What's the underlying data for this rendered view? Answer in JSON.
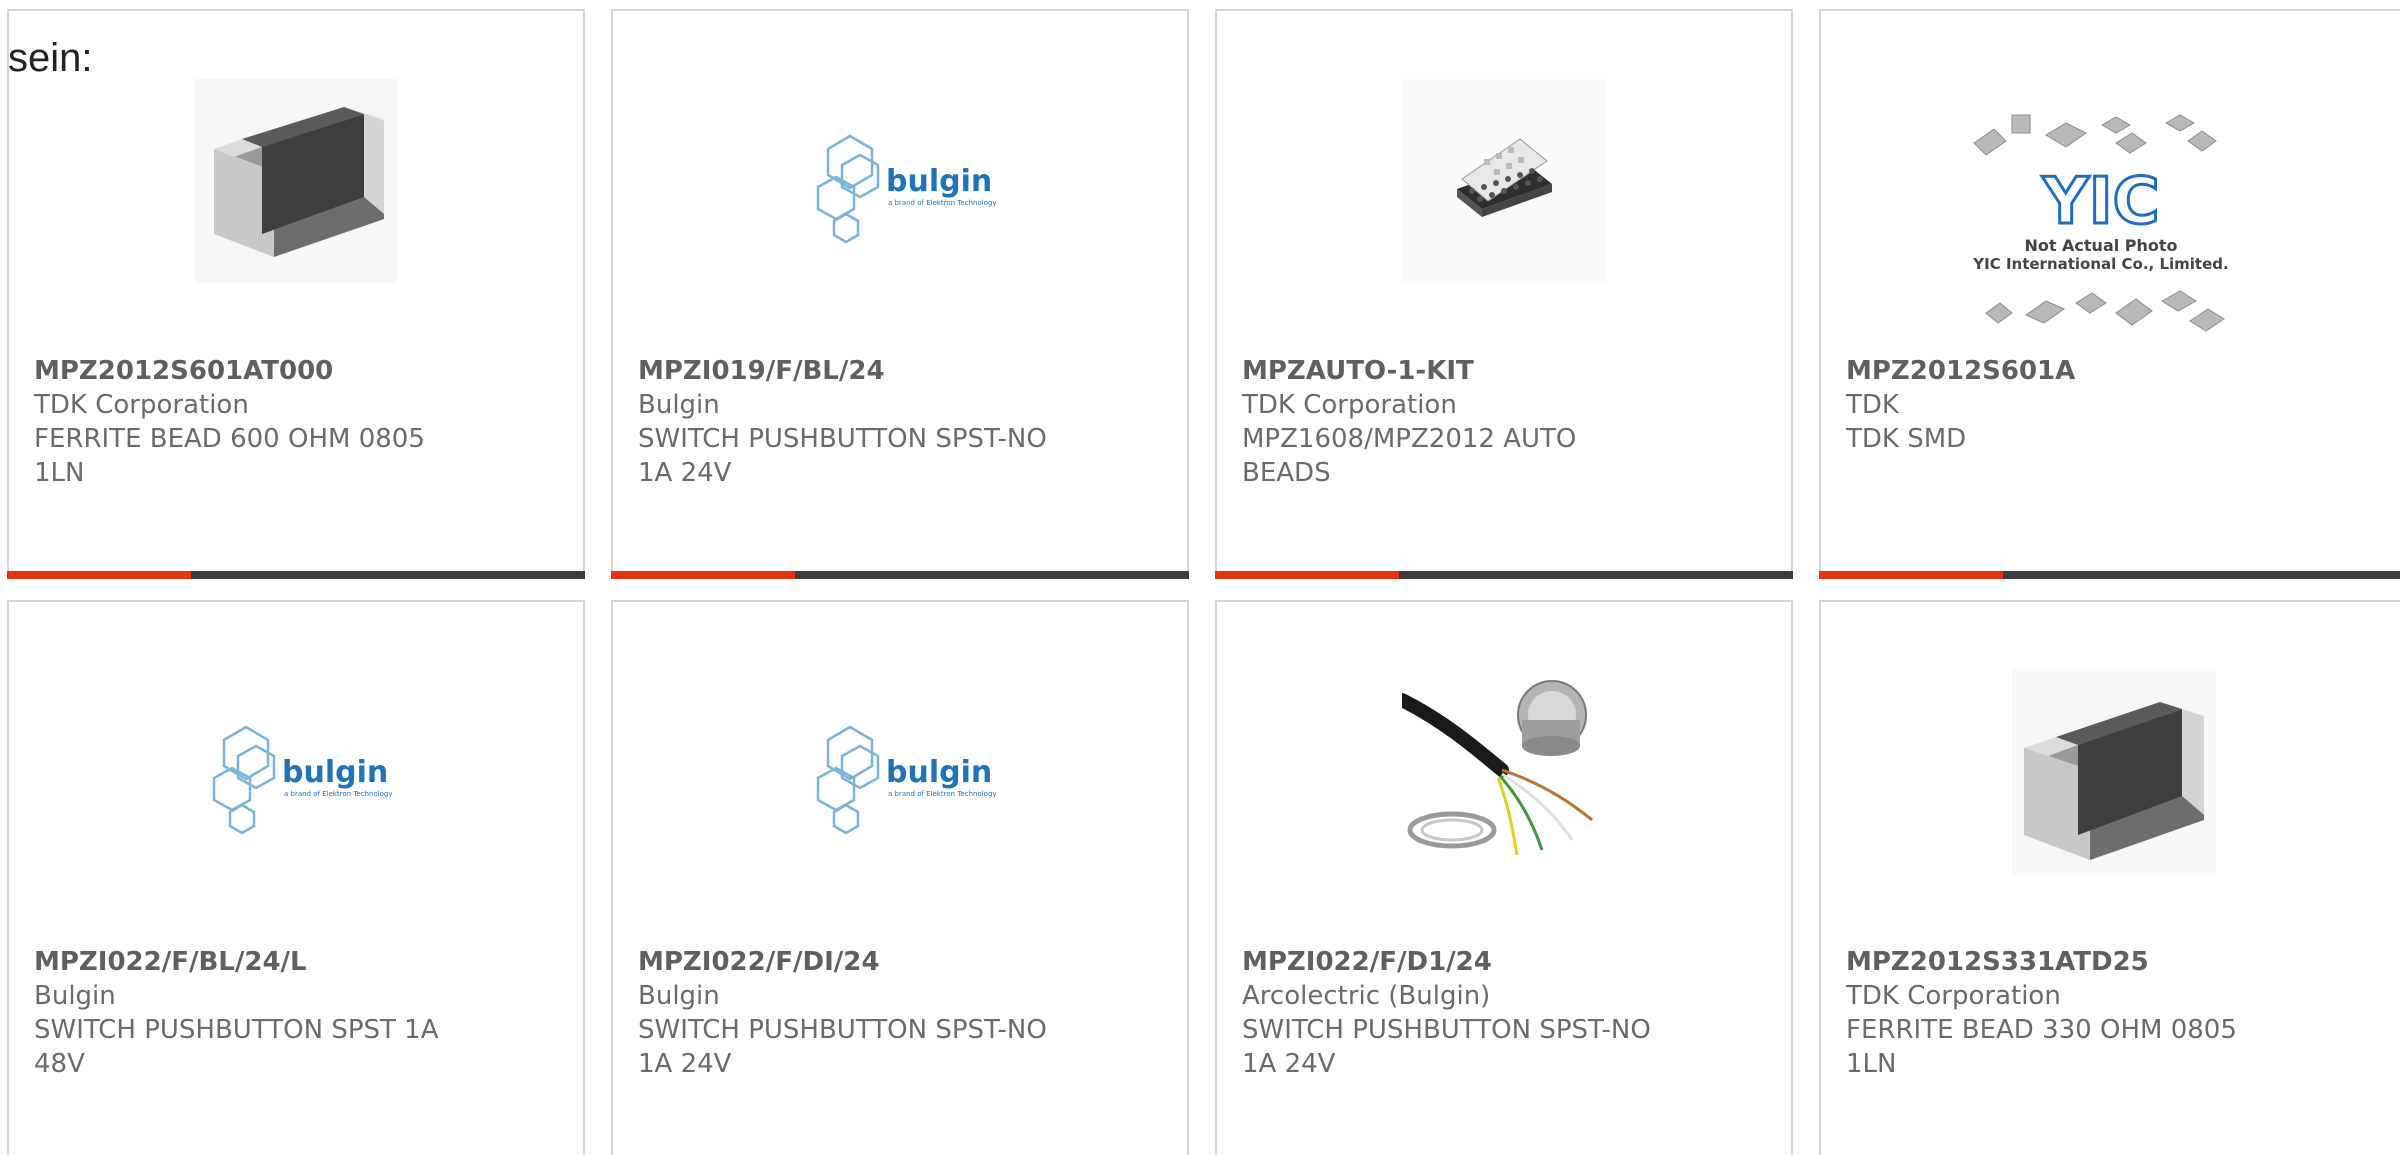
{
  "intro_text": "sein:",
  "colors": {
    "accent": "#e63312",
    "bar": "#3d3d3d",
    "border": "#d6d6d6",
    "text": "#666666"
  },
  "products": [
    {
      "part": "MPZ2012S601AT000",
      "manufacturer": "TDK Corporation",
      "description": "FERRITE BEAD 600 OHM 0805 1LN",
      "image": "chip-component-icon"
    },
    {
      "part": "MPZI019/F/BL/24",
      "manufacturer": "Bulgin",
      "description": "SWITCH PUSHBUTTON SPST-NO 1A 24V",
      "image": "bulgin-logo",
      "logo_text": "bulgin",
      "logo_subtext": "a brand of Elektron Technology"
    },
    {
      "part": "MPZAUTO-1-KIT",
      "manufacturer": "TDK Corporation",
      "description": "MPZ1608/MPZ2012 AUTO BEADS",
      "image": "kit-box-icon"
    },
    {
      "part": "MPZ2012S601A",
      "manufacturer": "TDK",
      "description": "TDK SMD",
      "image": "yic-placeholder-icon",
      "logo_text": "YIC",
      "logo_line1": "Not Actual Photo",
      "logo_line2": "YIC International Co., Limited."
    },
    {
      "part": "MPZI022/F/BL/24/L",
      "manufacturer": "Bulgin",
      "description": "SWITCH PUSHBUTTON SPST 1A 48V",
      "image": "bulgin-logo",
      "logo_text": "bulgin",
      "logo_subtext": "a brand of Elektron Technology"
    },
    {
      "part": "MPZI022/F/DI/24",
      "manufacturer": "Bulgin",
      "description": "SWITCH PUSHBUTTON SPST-NO 1A 24V",
      "image": "bulgin-logo",
      "logo_text": "bulgin",
      "logo_subtext": "a brand of Elektron Technology"
    },
    {
      "part": "MPZI022/F/D1/24",
      "manufacturer": "Arcolectric (Bulgin)",
      "description": "SWITCH PUSHBUTTON SPST-NO 1A 24V",
      "image": "pushbutton-switch-icon"
    },
    {
      "part": "MPZ2012S331ATD25",
      "manufacturer": "TDK Corporation",
      "description": "FERRITE BEAD 330 OHM 0805 1LN",
      "image": "chip-component-icon"
    }
  ]
}
